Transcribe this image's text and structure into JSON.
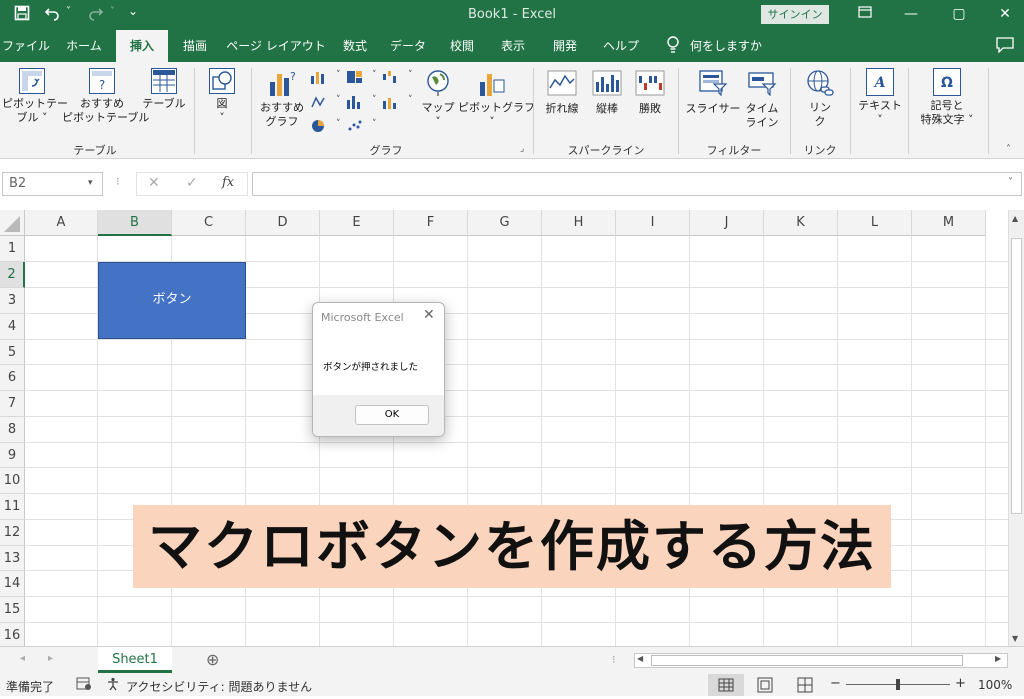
{
  "titlebar": {
    "title": "Book1  -  Excel",
    "signin_label": "サインイン",
    "save_icon": "save-icon",
    "undo_icon": "undo-icon",
    "redo_icon": "redo-icon"
  },
  "tabs": [
    "ファイル",
    "ホーム",
    "挿入",
    "描画",
    "ページ レイアウト",
    "数式",
    "データ",
    "校閲",
    "表示",
    "開発",
    "ヘルプ",
    "何をしますか"
  ],
  "active_tab": "挿入",
  "ribbon": {
    "table_group": {
      "label": "テーブル",
      "pivot_label": "ピボットテー\nブル ˅",
      "pivot_l1": "ピボットテー",
      "pivot_l2": "ブル ˅",
      "rec_pivot_l1": "おすすめ",
      "rec_pivot_l2": "ピボットテーブル",
      "table_label": "テーブル"
    },
    "illust_group": {
      "figure_label": "図",
      "chev": "˅"
    },
    "chart_group": {
      "label": "グラフ",
      "rec_chart_l1": "おすすめ",
      "rec_chart_l2": "グラフ",
      "map_label": "マップ",
      "pivot_chart_label": "ピボットグラフ"
    },
    "spark_group": {
      "label": "スパークライン",
      "line_label": "折れ線",
      "column_label": "縦棒",
      "winloss_label": "勝敗"
    },
    "filter_group": {
      "label": "フィルター",
      "slicer_label": "スライサー",
      "timeline_l1": "タイム",
      "timeline_l2": "ライン"
    },
    "link_group": {
      "label": "リンク",
      "link_l1": "リン",
      "link_l2": "ク"
    },
    "text_group": {
      "label": "テキスト"
    },
    "symbol_group": {
      "l1": "記号と",
      "l2": "特殊文字 ˅"
    }
  },
  "formula_bar": {
    "name_box": "B2",
    "cancel": "✕",
    "enter": "✓",
    "fx": "fx",
    "formula": ""
  },
  "columns": [
    "A",
    "B",
    "C",
    "D",
    "E",
    "F",
    "G",
    "H",
    "I",
    "J",
    "K",
    "L",
    "M"
  ],
  "rows": [
    "1",
    "2",
    "3",
    "4",
    "5",
    "6",
    "7",
    "8",
    "9",
    "10",
    "11",
    "12",
    "13",
    "14",
    "15",
    "16"
  ],
  "shape_button": {
    "label": "ボタン"
  },
  "dialog": {
    "title": "Microsoft Excel",
    "message": "ボタンが押されました",
    "ok_label": "OK"
  },
  "banner": {
    "text": "マクロボタンを作成する方法"
  },
  "sheets": {
    "active": "Sheet1",
    "add_icon": "⊕"
  },
  "status": {
    "ready": "準備完了",
    "accessibility": "アクセシビリティ: 問題ありません",
    "zoom": "100%"
  },
  "colors": {
    "excel_green": "#217346",
    "shape_fill": "#4472c4",
    "banner_fill": "#fbd4bd"
  }
}
